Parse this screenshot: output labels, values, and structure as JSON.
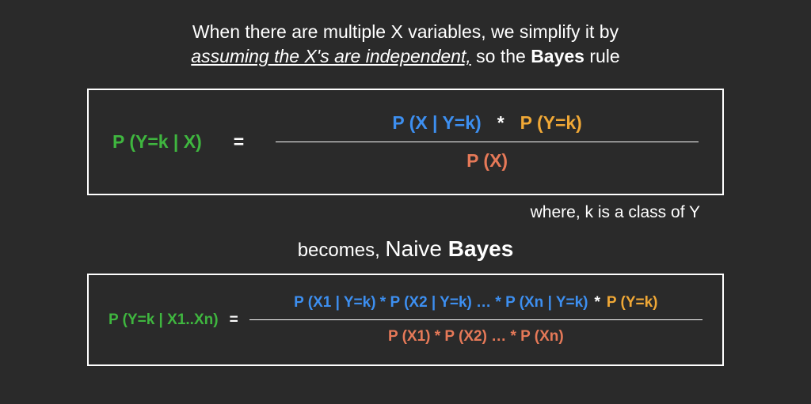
{
  "intro": {
    "line1": "When there are multiple X variables, we simplify it by",
    "assumption": "assuming the X's are independent,",
    "after": " so the ",
    "bayes": "Bayes",
    "tail": " rule"
  },
  "formula1": {
    "lhs": "P (Y=k | X)",
    "eq": "=",
    "num_likelihood": "P (X | Y=k)",
    "star": "*",
    "num_prior": "P (Y=k)",
    "denom": "P (X)"
  },
  "caption": "where, k is a class of Y",
  "becomes": {
    "word": "becomes, ",
    "naive": "Naive ",
    "bayes": "Bayes"
  },
  "formula2": {
    "lhs": "P (Y=k | X1..Xn)",
    "eq": "=",
    "num_likelihood": "P (X1 | Y=k) * P (X2 | Y=k) … * P (Xn | Y=k)",
    "star": "*",
    "num_prior": "P (Y=k)",
    "denom": "P (X1) * P (X2) … * P (Xn)"
  }
}
